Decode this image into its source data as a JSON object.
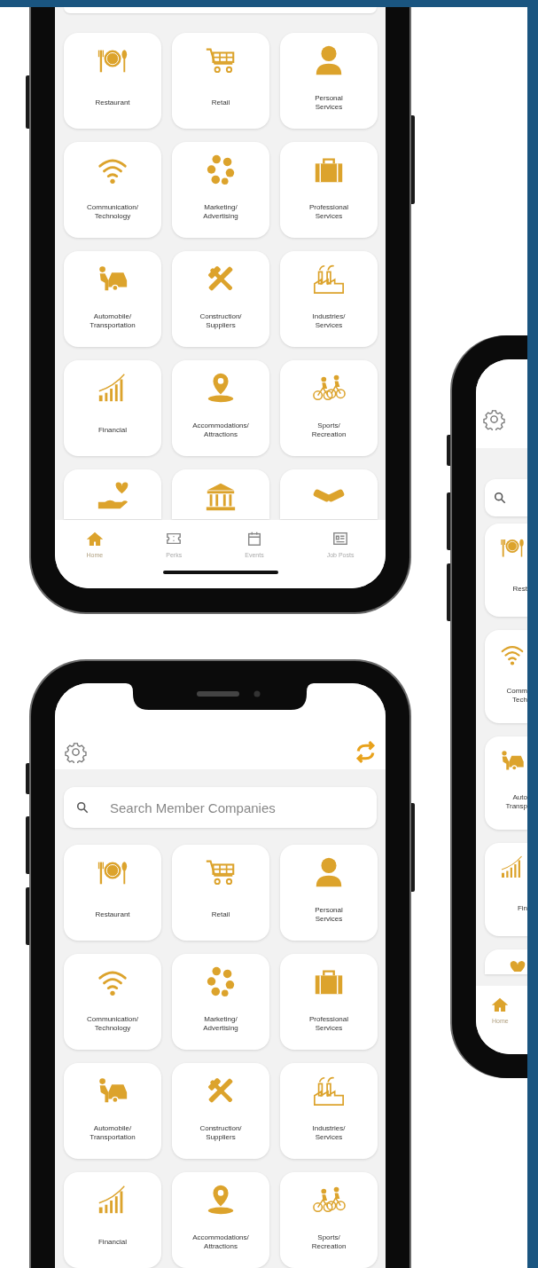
{
  "phone_top": {
    "categories": [
      {
        "kind": "labeled",
        "label": "Restaurant"
      },
      {
        "kind": "labeled",
        "label": "Retail"
      },
      {
        "kind": "labeled",
        "label": "Personal\nServices"
      },
      {
        "kind": "labeled",
        "label": "Communication/\nTechnology"
      },
      {
        "kind": "labeled",
        "label": "Marketing/\nAdvertising"
      },
      {
        "kind": "labeled",
        "label": "Professional\nServices"
      },
      {
        "kind": "labeled",
        "label": "Automobile/\nTransportation"
      },
      {
        "kind": "labeled",
        "label": "Construction/\nSuppliers"
      },
      {
        "kind": "labeled",
        "label": "Industries/\nServices"
      },
      {
        "kind": "labeled",
        "label": "Financial"
      },
      {
        "kind": "labeled",
        "label": "Accommodations/\nAttractions"
      },
      {
        "kind": "labeled",
        "label": "Sports/\nRecreation"
      },
      {
        "kind": "icon_only"
      },
      {
        "kind": "icon_only"
      },
      {
        "kind": "icon_only"
      }
    ],
    "tab_bar": [
      {
        "label": "Home",
        "selected": true
      },
      {
        "label": "Perks",
        "selected": false
      },
      {
        "label": "Events",
        "selected": false
      },
      {
        "label": "Job Posts",
        "selected": false
      }
    ]
  },
  "phone_bottom": {
    "search": {
      "placeholder": "Search Member Companies"
    },
    "categories": [
      {
        "kind": "labeled",
        "label": "Restaurant"
      },
      {
        "kind": "labeled",
        "label": "Retail"
      },
      {
        "kind": "labeled",
        "label": "Personal\nServices"
      },
      {
        "kind": "labeled",
        "label": "Communication/\nTechnology"
      },
      {
        "kind": "labeled",
        "label": "Marketing/\nAdvertising"
      },
      {
        "kind": "labeled",
        "label": "Professional\nServices"
      },
      {
        "kind": "labeled",
        "label": "Automobile/\nTransportation"
      },
      {
        "kind": "labeled",
        "label": "Construction/\nSuppliers"
      },
      {
        "kind": "labeled",
        "label": "Industries/\nServices"
      },
      {
        "kind": "labeled",
        "label": "Financial"
      },
      {
        "kind": "labeled",
        "label": "Accommodations/\nAttractions"
      },
      {
        "kind": "labeled",
        "label": "Sports/\nRecreation"
      }
    ]
  },
  "phone_right": {
    "categories": [
      {
        "kind": "labeled",
        "label": "Rest"
      },
      {
        "kind": "labeled",
        "label": "Comm\nTech"
      },
      {
        "kind": "labeled",
        "label": "Auto\nTransp"
      },
      {
        "kind": "labeled",
        "label": "Fin"
      },
      {
        "kind": "icon_only"
      }
    ],
    "tab_bar": [
      {
        "label": "Home",
        "selected": true
      }
    ]
  }
}
